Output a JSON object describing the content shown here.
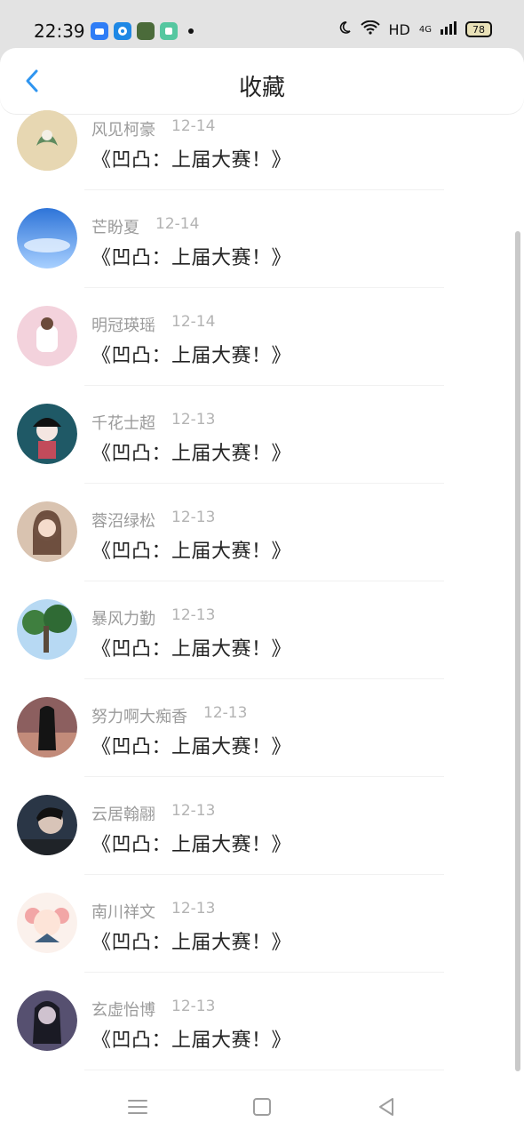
{
  "status_bar": {
    "time": "22:39",
    "network": "HD",
    "signal": "4G",
    "battery": "78"
  },
  "header": {
    "title": "收藏"
  },
  "favorites": [
    {
      "user": "风见柯豪",
      "date": "12-14",
      "title": "《凹凸：上届大赛！》",
      "avatar_color": "#d9c9a6"
    },
    {
      "user": "芒盼夏",
      "date": "12-14",
      "title": "《凹凸：上届大赛！》",
      "avatar_color": "#4c8fe0"
    },
    {
      "user": "明冠瑛瑶",
      "date": "12-14",
      "title": "《凹凸：上届大赛！》",
      "avatar_color": "#f0c6d0"
    },
    {
      "user": "千花士超",
      "date": "12-13",
      "title": "《凹凸：上届大赛！》",
      "avatar_color": "#1d5d6a"
    },
    {
      "user": "蓉沼绿松",
      "date": "12-13",
      "title": "《凹凸：上届大赛！》",
      "avatar_color": "#d8bfa8"
    },
    {
      "user": "暴风力勤",
      "date": "12-13",
      "title": "《凹凸：上届大赛！》",
      "avatar_color": "#6aa06a"
    },
    {
      "user": "努力啊大痴香",
      "date": "12-13",
      "title": "《凹凸：上届大赛！》",
      "avatar_color": "#7a4e4e"
    },
    {
      "user": "云居翰翮",
      "date": "12-13",
      "title": "《凹凸：上届大赛！》",
      "avatar_color": "#2d3b4d"
    },
    {
      "user": "南川祥文",
      "date": "12-13",
      "title": "《凹凸：上届大赛！》",
      "avatar_color": "#f4c8bd"
    },
    {
      "user": "玄虚怡博",
      "date": "12-13",
      "title": "《凹凸：上届大赛！》",
      "avatar_color": "#4a4660"
    }
  ],
  "nav": {
    "menu_icon": "menu-icon",
    "home_icon": "home-square-icon",
    "back_icon": "back-triangle-icon"
  }
}
